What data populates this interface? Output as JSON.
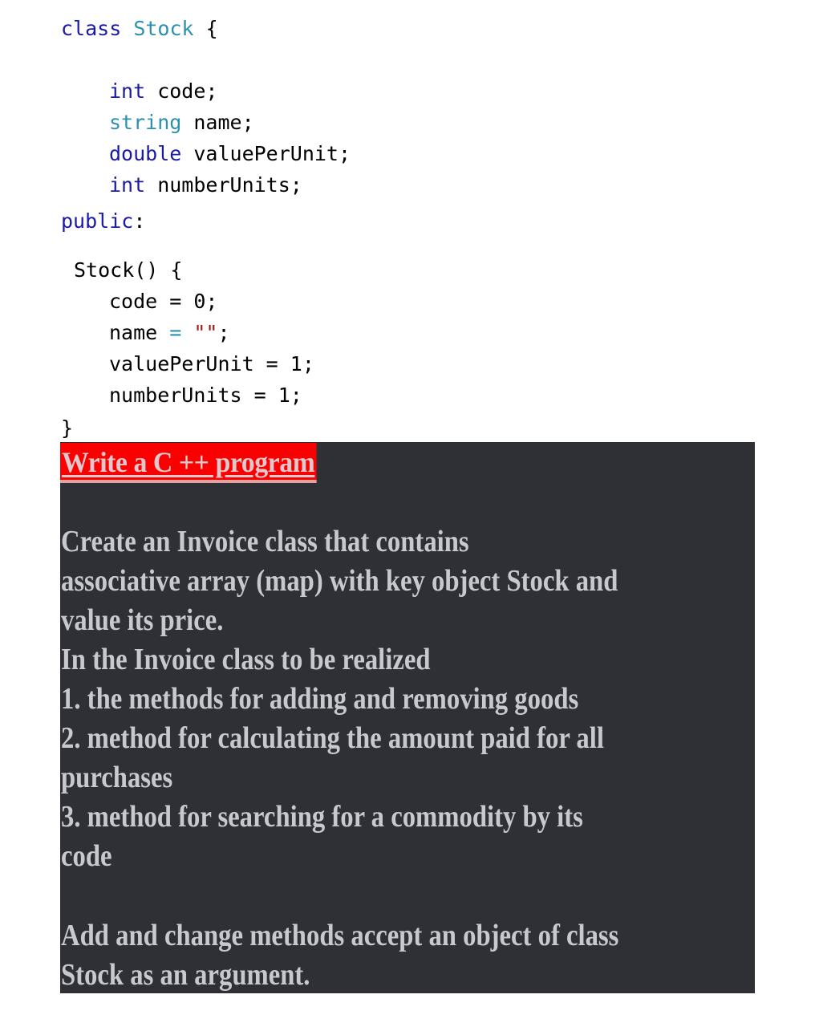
{
  "code": {
    "lines": [
      {
        "keyword": "class",
        "type": "Stock",
        "rest": " {"
      },
      {
        "keyword": "int",
        "rest": " code;"
      },
      {
        "type": "string",
        "rest": " name;"
      },
      {
        "keyword": "double",
        "rest": " valuePerUnit;"
      },
      {
        "keyword": "int",
        "rest": " numberUnits;"
      },
      {
        "keyword": "public",
        "rest": ":"
      },
      {
        "rest": "Stock() {"
      },
      {
        "rest": "code = 0;"
      },
      {
        "pre": "name ",
        "op": "=",
        "str": " \"\"",
        "rest": ";"
      },
      {
        "rest": "valuePerUnit = 1;"
      },
      {
        "rest": "numberUnits = 1;"
      },
      {
        "rest": "}"
      }
    ]
  },
  "task": {
    "title": "Write a C ++ program",
    "paragraphs": [
      "Create an Invoice class that contains",
      "associative array (map) with key object Stock and",
      "value its price.",
      "In the Invoice class to be realized",
      "1. the methods for adding and removing goods",
      "2. method for calculating the amount paid for all",
      "purchases",
      "3. method for searching for a commodity by its",
      "code",
      "Add and change methods accept an object of class",
      "Stock as an argument."
    ]
  },
  "colors": {
    "keyword": "#1a1aa6",
    "type": "#2b91af",
    "string": "#a31515",
    "title_bg": "#fb0000",
    "panel_bg": "#2f3035",
    "panel_text": "#c8c9cf"
  }
}
